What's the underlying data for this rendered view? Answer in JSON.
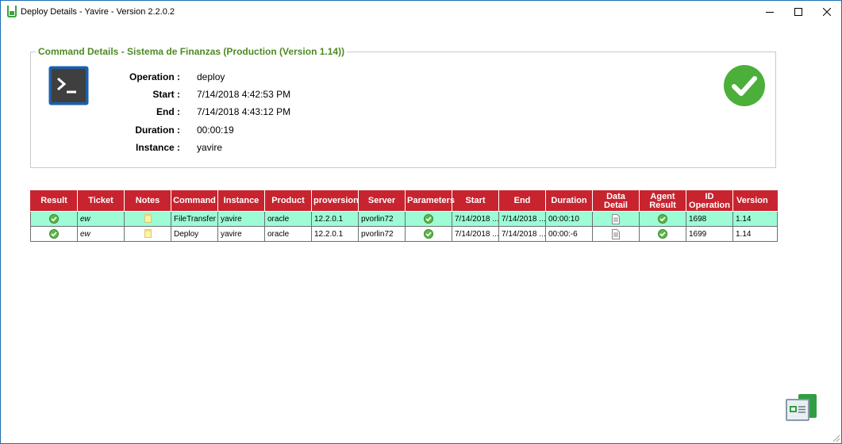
{
  "window": {
    "title": "Deploy Details - Yavire - Version 2.2.0.2",
    "icon": "app-bucket-icon",
    "controls": [
      "minimize-icon",
      "maximize-icon",
      "close-icon"
    ]
  },
  "details": {
    "group_title": "Command Details - Sistema de Finanzas (Production (Version 1.14))",
    "console_icon": "terminal-icon",
    "status_icon": "success-check-icon",
    "fields": [
      {
        "label": "Operation :",
        "value": "deploy"
      },
      {
        "label": "Start :",
        "value": "7/14/2018 4:42:53 PM"
      },
      {
        "label": "End :",
        "value": "7/14/2018 4:43:12 PM"
      },
      {
        "label": "Duration :",
        "value": "00:00:19"
      },
      {
        "label": "Instance :",
        "value": "yavire"
      }
    ]
  },
  "table": {
    "headers": [
      {
        "l1": "Result",
        "l2": ""
      },
      {
        "l1": "Ticket",
        "l2": ""
      },
      {
        "l1": "Notes",
        "l2": ""
      },
      {
        "l1": "Command",
        "l2": ""
      },
      {
        "l1": "Instance",
        "l2": ""
      },
      {
        "l1": "Product",
        "l2": ""
      },
      {
        "l1": "proversion",
        "l2": ""
      },
      {
        "l1": "Server",
        "l2": ""
      },
      {
        "l1": "Parameters",
        "l2": ""
      },
      {
        "l1": "Start",
        "l2": ""
      },
      {
        "l1": "End",
        "l2": ""
      },
      {
        "l1": "Duration",
        "l2": ""
      },
      {
        "l1": "Data",
        "l2": "Detail"
      },
      {
        "l1": "Agent",
        "l2": "Result"
      },
      {
        "l1": "ID",
        "l2": "Operation"
      },
      {
        "l1": "Version",
        "l2": ""
      }
    ],
    "rows": [
      {
        "ticket": "ew",
        "command": "FileTransfer",
        "instance": "yavire",
        "product": "oracle",
        "proversion": "12.2.0.1",
        "server": "pvorlin72",
        "start": "7/14/2018 ...",
        "end": "7/14/2018 ...",
        "duration": "00:00:10",
        "id_operation": "1698",
        "version": "1.14"
      },
      {
        "ticket": "ew",
        "command": "Deploy",
        "instance": "yavire",
        "product": "oracle",
        "proversion": "12.2.0.1",
        "server": "pvorlin72",
        "start": "7/14/2018 ...",
        "end": "7/14/2018 ...",
        "duration": "00:00:-6",
        "id_operation": "1699",
        "version": "1.14"
      }
    ]
  },
  "colors": {
    "header_bg": "#c7242f",
    "selected_row": "#9dfcd6",
    "group_title": "#4e8a22",
    "success": "#4caf3a"
  }
}
